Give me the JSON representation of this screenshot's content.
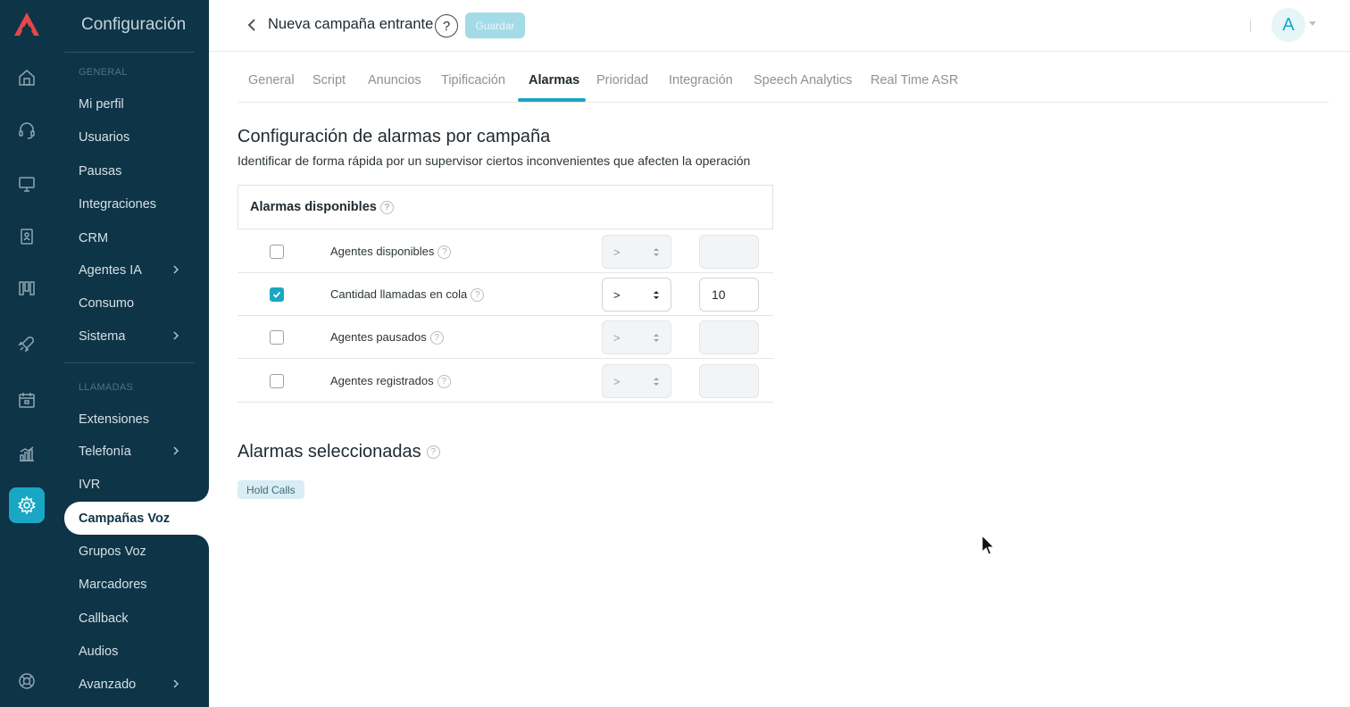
{
  "sidebar": {
    "title": "Configuración",
    "sections": {
      "general": "GENERAL",
      "llamadas": "LLAMADAS"
    },
    "items": {
      "mi_perfil": "Mi perfil",
      "usuarios": "Usuarios",
      "pausas": "Pausas",
      "integraciones": "Integraciones",
      "crm": "CRM",
      "agentes_ia": "Agentes IA",
      "consumo": "Consumo",
      "sistema": "Sistema",
      "extensiones": "Extensiones",
      "telefonia": "Telefonía",
      "ivr": "IVR",
      "campanas_voz": "Campañas Voz",
      "grupos_voz": "Grupos Voz",
      "marcadores": "Marcadores",
      "callback": "Callback",
      "audios": "Audios",
      "avanzado": "Avanzado"
    }
  },
  "header": {
    "title": "Nueva campaña entrante",
    "help": "?",
    "save_label": "Guardar",
    "avatar_initial": "A"
  },
  "tabs": {
    "general": "General",
    "script": "Script",
    "anuncios": "Anuncios",
    "tipificacion": "Tipificación",
    "alarmas": "Alarmas",
    "prioridad": "Prioridad",
    "integracion": "Integración",
    "speech": "Speech Analytics",
    "realtime": "Real Time ASR"
  },
  "main": {
    "title": "Configuración de alarmas por campaña",
    "subtitle": "Identificar de forma rápida por un supervisor ciertos inconvenientes que afecten la operación",
    "available_label": "Alarmas disponibles",
    "q": "?",
    "alarms": [
      {
        "label": "Agentes disponibles",
        "checked": false,
        "operator": ">",
        "value": ""
      },
      {
        "label": "Cantidad llamadas en cola",
        "checked": true,
        "operator": ">",
        "value": "10"
      },
      {
        "label": "Agentes pausados",
        "checked": false,
        "operator": ">",
        "value": ""
      },
      {
        "label": "Agentes registrados",
        "checked": false,
        "operator": ">",
        "value": ""
      }
    ],
    "selected_title": "Alarmas seleccionadas",
    "selected_chip": "Hold Calls"
  },
  "colors": {
    "sidebar_bg": "#0d3447",
    "accent": "#1aa7c4",
    "brand_logo": "#e8474a"
  }
}
